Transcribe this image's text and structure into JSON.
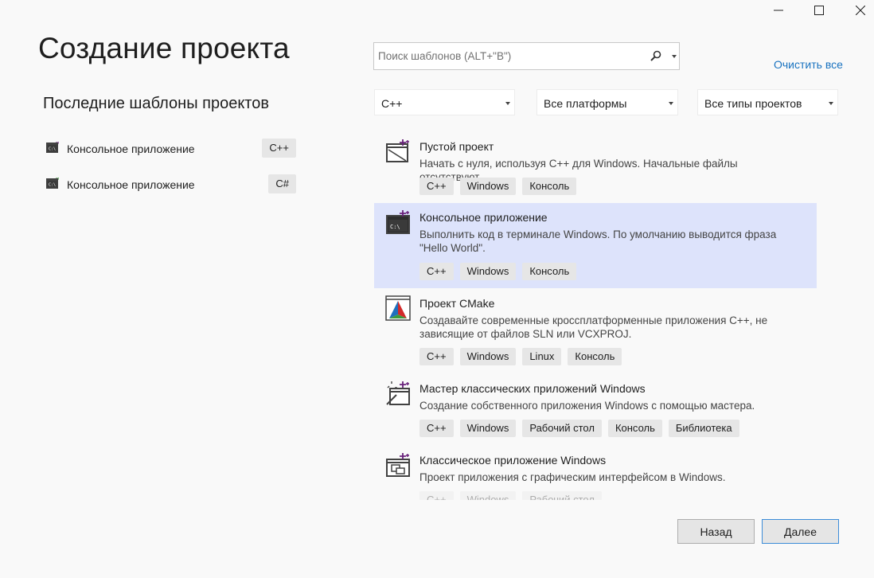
{
  "window": {
    "minimize_icon": "minimize-icon",
    "maximize_icon": "maximize-icon",
    "close_icon": "close-icon"
  },
  "header": {
    "title": "Создание проекта",
    "search_placeholder": "Поиск шаблонов (ALT+\"В\")",
    "clear_all": "Очистить все"
  },
  "recent": {
    "title": "Последние шаблоны проектов",
    "items": [
      {
        "label": "Консольное приложение",
        "lang": "C++"
      },
      {
        "label": "Консольное приложение",
        "lang": "C#"
      }
    ]
  },
  "filters": {
    "language": "C++",
    "platform": "Все платформы",
    "project_type": "Все типы проектов"
  },
  "templates": [
    {
      "name": "Пустой проект",
      "description": "Начать с нуля, используя C++ для Windows. Начальные файлы отсутствуют.",
      "tags": [
        "C++",
        "Windows",
        "Консоль"
      ],
      "icon": "empty-project-icon"
    },
    {
      "name": "Консольное приложение",
      "description": "Выполнить код в терминале Windows. По умолчанию выводится фраза \"Hello World\".",
      "tags": [
        "C++",
        "Windows",
        "Консоль"
      ],
      "icon": "console-app-icon",
      "selected": true
    },
    {
      "name": "Проект CMake",
      "description": "Создавайте современные кроссплатформенные приложения C++, не зависящие от файлов SLN или VCXPROJ.",
      "tags": [
        "C++",
        "Windows",
        "Linux",
        "Консоль"
      ],
      "icon": "cmake-icon"
    },
    {
      "name": "Мастер классических приложений Windows",
      "description": "Создание собственного приложения Windows с помощью мастера.",
      "tags": [
        "C++",
        "Windows",
        "Рабочий стол",
        "Консоль",
        "Библиотека"
      ],
      "icon": "wizard-icon"
    },
    {
      "name": "Классическое приложение Windows",
      "description": "Проект приложения с графическим интерфейсом в Windows.",
      "tags": [
        "C++",
        "Windows",
        "Рабочий стол"
      ],
      "icon": "desktop-app-icon"
    }
  ],
  "footer": {
    "back": "Назад",
    "next": "Далее"
  },
  "colors": {
    "selected_bg": "#dde3fb",
    "link": "#1a73c0",
    "primary_border": "#3c8cd8"
  }
}
